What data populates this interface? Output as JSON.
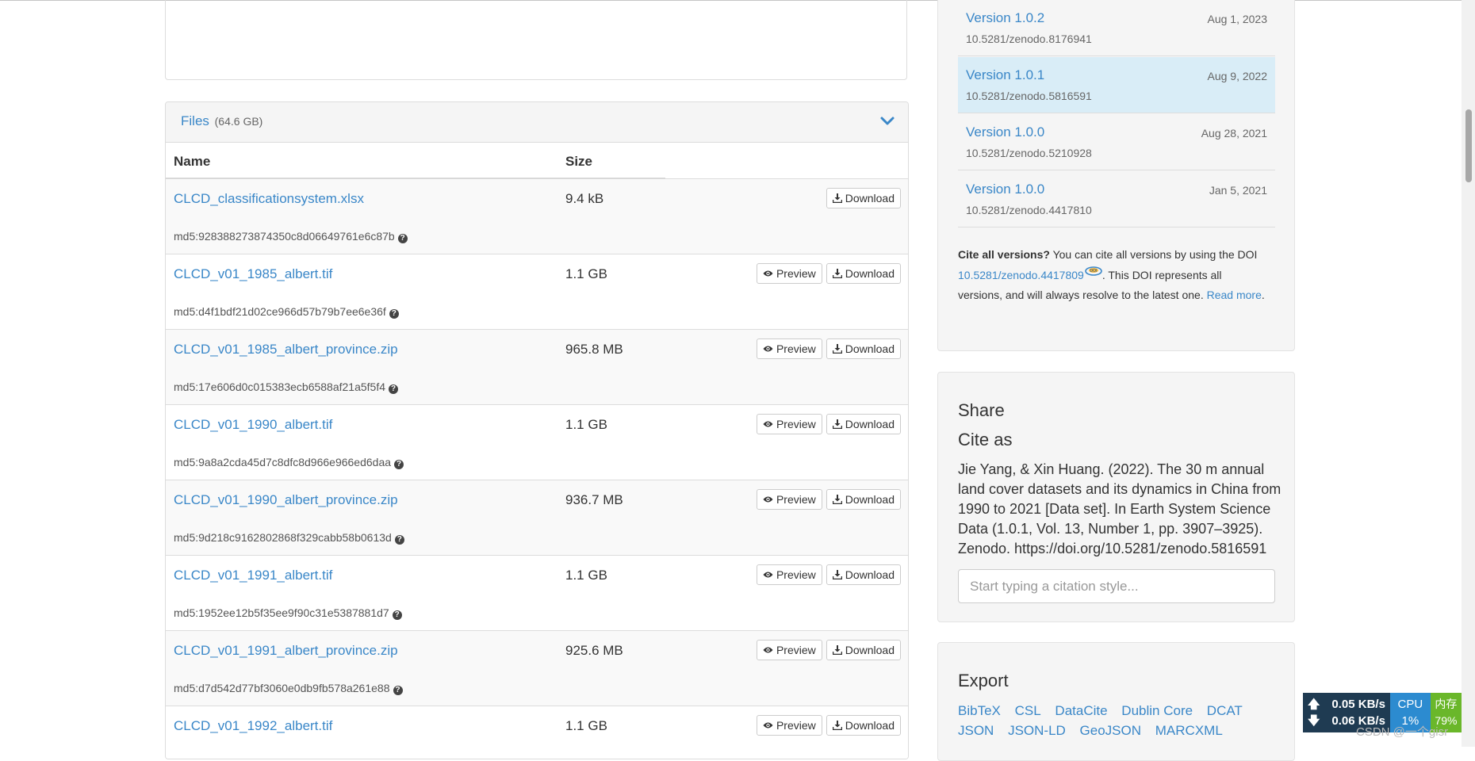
{
  "files": {
    "title": "Files",
    "total_size": "(64.6 GB)",
    "col_name": "Name",
    "col_size": "Size",
    "preview_label": "Preview",
    "download_label": "Download",
    "rows": [
      {
        "name": "CLCD_classificationsystem.xlsx",
        "size": "9.4 kB",
        "md5": "md5:928388273874350c8d06649761e6c87b",
        "preview": false
      },
      {
        "name": "CLCD_v01_1985_albert.tif",
        "size": "1.1 GB",
        "md5": "md5:d4f1bdf21d02ce966d57b79b7ee6e36f",
        "preview": true
      },
      {
        "name": "CLCD_v01_1985_albert_province.zip",
        "size": "965.8 MB",
        "md5": "md5:17e606d0c015383ecb6588af21a5f5f4",
        "preview": true
      },
      {
        "name": "CLCD_v01_1990_albert.tif",
        "size": "1.1 GB",
        "md5": "md5:9a8a2cda45d7c8dfc8d966e966ed6daa",
        "preview": true
      },
      {
        "name": "CLCD_v01_1990_albert_province.zip",
        "size": "936.7 MB",
        "md5": "md5:9d218c9162802868f329cabb58b0613d",
        "preview": true
      },
      {
        "name": "CLCD_v01_1991_albert.tif",
        "size": "1.1 GB",
        "md5": "md5:1952ee12b5f35ee9f90c31e5387881d7",
        "preview": true
      },
      {
        "name": "CLCD_v01_1991_albert_province.zip",
        "size": "925.6 MB",
        "md5": "md5:d7d542d77bf3060e0db9fb578a261e88",
        "preview": true
      },
      {
        "name": "CLCD_v01_1992_albert.tif",
        "size": "1.1 GB",
        "md5": "",
        "preview": true
      }
    ]
  },
  "versions": {
    "items": [
      {
        "name": "Version 1.0.2",
        "date": "Aug 1, 2023",
        "doi": "10.5281/zenodo.8176941",
        "active": false
      },
      {
        "name": "Version 1.0.1",
        "date": "Aug 9, 2022",
        "doi": "10.5281/zenodo.5816591",
        "active": true
      },
      {
        "name": "Version 1.0.0",
        "date": "Aug 28, 2021",
        "doi": "10.5281/zenodo.5210928",
        "active": false
      },
      {
        "name": "Version 1.0.0",
        "date": "Jan 5, 2021",
        "doi": "10.5281/zenodo.4417810",
        "active": false
      }
    ],
    "cite_all_bold": "Cite all versions?",
    "cite_all_text": " You can cite all versions by using the DOI ",
    "cite_all_doi": "10.5281/zenodo.4417809",
    "cite_all_rest": ". This DOI represents all versions, and will always resolve to the latest one. ",
    "read_more": "Read more",
    "period": "."
  },
  "share": {
    "title": "Share",
    "cite_as": "Cite as",
    "citation": "Jie Yang, & Xin Huang. (2022). The 30 m annual land cover datasets and its dynamics in China from 1990 to 2021 [Data set]. In Earth System Science Data (1.0.1, Vol. 13, Number 1, pp. 3907–3925). Zenodo. https://doi.org/10.5281/zenodo.5816591",
    "style_placeholder": "Start typing a citation style..."
  },
  "export": {
    "title": "Export",
    "formats": [
      "BibTeX",
      "CSL",
      "DataCite",
      "Dublin Core",
      "DCAT",
      "JSON",
      "JSON-LD",
      "GeoJSON",
      "MARCXML"
    ]
  },
  "netmon": {
    "up": "0.05 KB/s",
    "down": "0.06 KB/s",
    "cpu_label": "CPU",
    "cpu_value": "1%",
    "mem_label": "内存",
    "mem_value": "79%",
    "watermark": "CSDN @一个gisr"
  }
}
